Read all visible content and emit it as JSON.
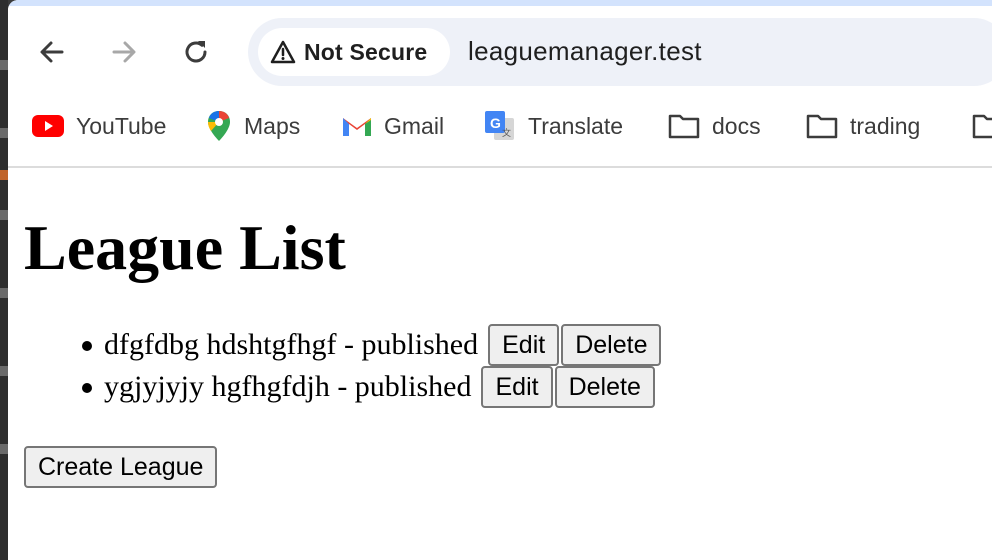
{
  "browser": {
    "security_label": "Not Secure",
    "url": "leaguemanager.test"
  },
  "bookmarks": [
    {
      "label": "YouTube",
      "icon": "youtube-icon"
    },
    {
      "label": "Maps",
      "icon": "maps-icon"
    },
    {
      "label": "Gmail",
      "icon": "gmail-icon"
    },
    {
      "label": "Translate",
      "icon": "translate-icon"
    },
    {
      "label": "docs",
      "icon": "folder-icon"
    },
    {
      "label": "trading",
      "icon": "folder-icon"
    }
  ],
  "page": {
    "title": "League List",
    "leagues": [
      {
        "text": "dfgfdbg hdshtgfhgf - published",
        "edit_label": "Edit",
        "delete_label": "Delete"
      },
      {
        "text": "ygjyjyjy hgfhgfdjh - published",
        "edit_label": "Edit",
        "delete_label": "Delete"
      }
    ],
    "create_label": "Create League"
  },
  "colors": {
    "tab_strip": "#d3e3fd",
    "omnibox_bg": "#eef1f8",
    "button_bg": "#efefef",
    "button_border": "#767676"
  }
}
